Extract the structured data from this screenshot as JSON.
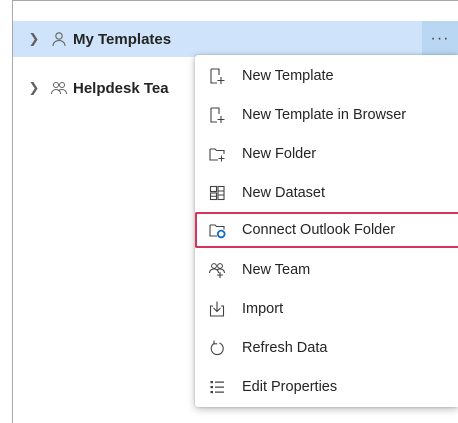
{
  "tree": {
    "nodes": [
      {
        "label": "My Templates",
        "icon": "person-icon",
        "selected": true,
        "more_label": "···"
      },
      {
        "label": "Helpdesk Tea",
        "icon": "people-team-icon",
        "selected": false
      }
    ]
  },
  "context_menu": {
    "items": [
      {
        "label": "New Template",
        "icon": "new-template-icon"
      },
      {
        "label": "New Template in Browser",
        "icon": "new-template-browser-icon"
      },
      {
        "label": "New Folder",
        "icon": "new-folder-icon"
      },
      {
        "label": "New Dataset",
        "icon": "dataset-icon"
      },
      {
        "label": "Connect Outlook Folder",
        "icon": "outlook-folder-icon",
        "highlighted": true
      },
      {
        "label": "New Team",
        "icon": "team-icon"
      },
      {
        "label": "Import",
        "icon": "import-icon"
      },
      {
        "label": "Refresh Data",
        "icon": "refresh-icon"
      },
      {
        "label": "Edit Properties",
        "icon": "properties-icon"
      }
    ]
  },
  "colors": {
    "selection": "#cfe4fa",
    "highlight_border": "#d6345a",
    "outlook_accent": "#0f6cbd"
  }
}
